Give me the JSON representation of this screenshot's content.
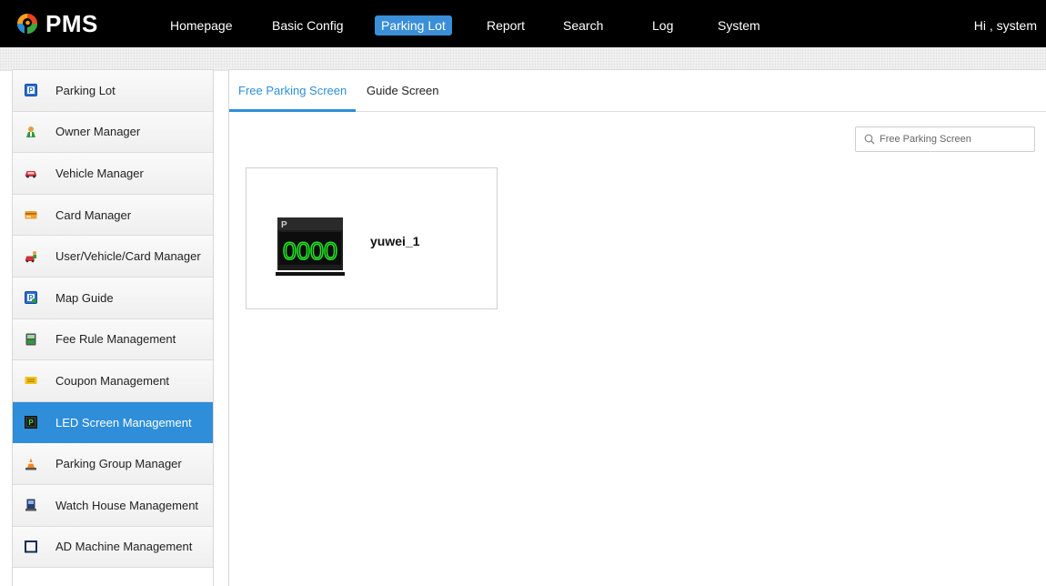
{
  "app": {
    "name": "PMS",
    "greeting": "Hi , system"
  },
  "nav": {
    "items": [
      {
        "label": "Homepage",
        "active": false
      },
      {
        "label": "Basic Config",
        "active": false
      },
      {
        "label": "Parking Lot",
        "active": true
      },
      {
        "label": "Report",
        "active": false
      },
      {
        "label": "Search",
        "active": false
      },
      {
        "label": "Log",
        "active": false
      },
      {
        "label": "System",
        "active": false
      }
    ]
  },
  "sidebar": {
    "items": [
      {
        "label": "Parking Lot",
        "icon": "parking-icon"
      },
      {
        "label": "Owner Manager",
        "icon": "owner-icon"
      },
      {
        "label": "Vehicle Manager",
        "icon": "car-icon"
      },
      {
        "label": "Card Manager",
        "icon": "card-icon"
      },
      {
        "label": "User/Vehicle/Card Manager",
        "icon": "user-vehicle-icon"
      },
      {
        "label": "Map Guide",
        "icon": "map-guide-icon"
      },
      {
        "label": "Fee Rule Management",
        "icon": "fee-rule-icon"
      },
      {
        "label": "Coupon Management",
        "icon": "coupon-icon"
      },
      {
        "label": "LED Screen Management",
        "icon": "led-screen-icon",
        "active": true
      },
      {
        "label": "Parking Group Manager",
        "icon": "cone-icon"
      },
      {
        "label": "Watch House Management",
        "icon": "watch-house-icon"
      },
      {
        "label": "AD Machine Management",
        "icon": "monitor-icon"
      }
    ]
  },
  "tabs": [
    {
      "label": "Free Parking Screen",
      "active": true
    },
    {
      "label": "Guide Screen",
      "active": false
    }
  ],
  "search": {
    "placeholder": "Free Parking Screen",
    "value": ""
  },
  "screens": [
    {
      "name": "yuwei_1",
      "display": "0000",
      "icon": "led-display-icon"
    }
  ],
  "colors": {
    "accent": "#2f8ed9",
    "topbar": "#000000",
    "led_digits": "#22dd22"
  }
}
